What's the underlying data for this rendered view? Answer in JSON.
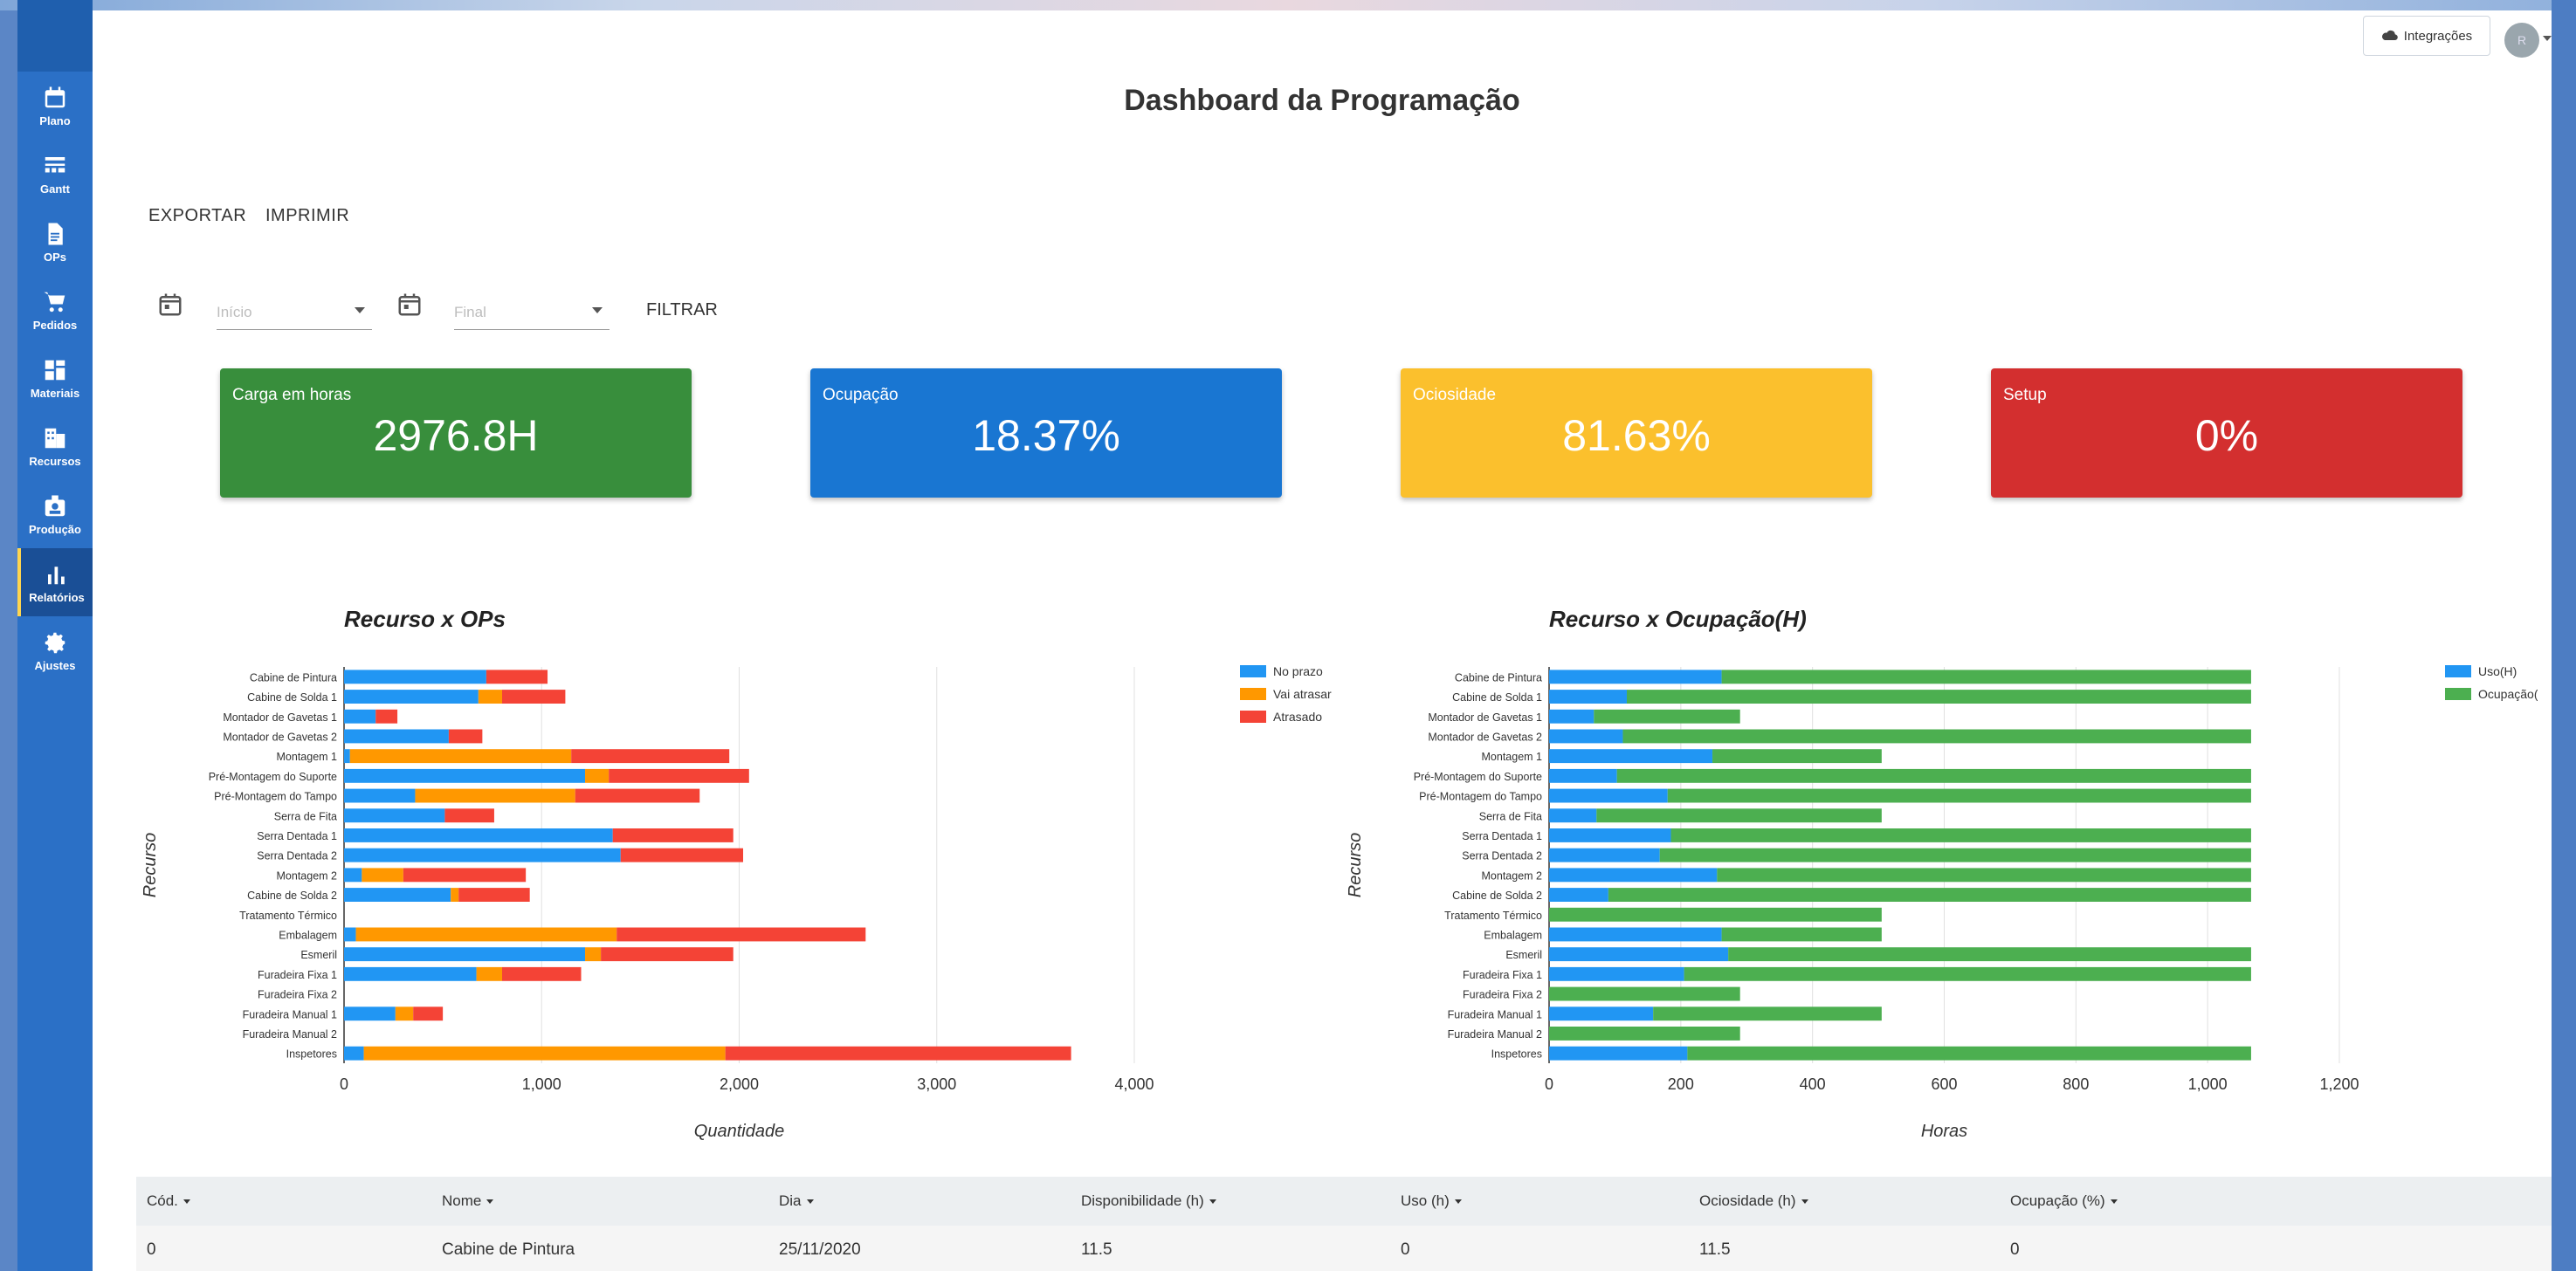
{
  "header": {
    "integrations_label": "Integrações",
    "avatar_initials": "R"
  },
  "sidebar": {
    "items": [
      {
        "label": "Plano",
        "icon": "calendar-icon"
      },
      {
        "label": "Gantt",
        "icon": "gantt-icon"
      },
      {
        "label": "OPs",
        "icon": "document-icon"
      },
      {
        "label": "Pedidos",
        "icon": "cart-icon"
      },
      {
        "label": "Materiais",
        "icon": "grid-icon"
      },
      {
        "label": "Recursos",
        "icon": "building-icon"
      },
      {
        "label": "Produção",
        "icon": "badge-icon"
      },
      {
        "label": "Relatórios",
        "icon": "bar-chart-icon",
        "active": true
      },
      {
        "label": "Ajustes",
        "icon": "gear-icon"
      }
    ]
  },
  "page": {
    "title": "Dashboard da Programação",
    "export_label": "EXPORTAR",
    "print_label": "IMPRIMIR"
  },
  "filters": {
    "start_placeholder": "Início",
    "end_placeholder": "Final",
    "filter_label": "FILTRAR"
  },
  "kpis": [
    {
      "label": "Carga em horas",
      "value": "2976.8H",
      "color": "#388e3c"
    },
    {
      "label": "Ocupação",
      "value": "18.37%",
      "color": "#1976d2"
    },
    {
      "label": "Ociosidade",
      "value": "81.63%",
      "color": "#fbc02d"
    },
    {
      "label": "Setup",
      "value": "0%",
      "color": "#d32f2f"
    }
  ],
  "chart_data": [
    {
      "type": "bar",
      "orientation": "horizontal",
      "stacked": true,
      "title": "Recurso x OPs",
      "xlabel": "Quantidade",
      "ylabel": "Recurso",
      "xlim": [
        0,
        4000
      ],
      "xticks": [
        "0",
        "1,000",
        "2,000",
        "3,000",
        "4,000"
      ],
      "grid": true,
      "legend_position": "right",
      "categories": [
        "Cabine de Pintura",
        "Cabine de Solda 1",
        "Montador de Gavetas 1",
        "Montador de Gavetas 2",
        "Montagem 1",
        "Pré-Montagem do Suporte",
        "Pré-Montagem do Tampo",
        "Serra de Fita",
        "Serra Dentada 1",
        "Serra Dentada 2",
        "Montagem 2",
        "Cabine de Solda 2",
        "Tratamento Térmico",
        "Embalagem",
        "Esmeril",
        "Furadeira Fixa 1",
        "Furadeira Fixa 2",
        "Furadeira Manual 1",
        "Furadeira Manual 2",
        "Inspetores"
      ],
      "series": [
        {
          "name": "No prazo",
          "color": "#2196f3",
          "values": [
            720,
            680,
            160,
            530,
            30,
            1220,
            360,
            510,
            1360,
            1400,
            90,
            540,
            0,
            60,
            1220,
            670,
            0,
            260,
            0,
            100
          ]
        },
        {
          "name": "Vai atrasar",
          "color": "#ff9800",
          "values": [
            0,
            120,
            0,
            0,
            1120,
            120,
            810,
            0,
            0,
            0,
            210,
            40,
            0,
            1320,
            80,
            130,
            0,
            90,
            0,
            1830
          ]
        },
        {
          "name": "Atrasado",
          "color": "#f44336",
          "values": [
            310,
            320,
            110,
            170,
            800,
            710,
            630,
            250,
            610,
            620,
            620,
            360,
            0,
            1260,
            670,
            400,
            0,
            150,
            0,
            1750
          ]
        }
      ]
    },
    {
      "type": "bar",
      "orientation": "horizontal",
      "stacked": true,
      "title": "Recurso x Ocupação(H)",
      "xlabel": "Horas",
      "ylabel": "Recurso",
      "xlim": [
        0,
        1200
      ],
      "xticks": [
        "0",
        "200",
        "400",
        "600",
        "800",
        "1,000",
        "1,200"
      ],
      "grid": true,
      "legend_position": "right",
      "categories": [
        "Cabine de Pintura",
        "Cabine de Solda 1",
        "Montador de Gavetas 1",
        "Montador de Gavetas 2",
        "Montagem 1",
        "Pré-Montagem do Suporte",
        "Pré-Montagem do Tampo",
        "Serra de Fita",
        "Serra Dentada 1",
        "Serra Dentada 2",
        "Montagem 2",
        "Cabine de Solda 2",
        "Tratamento Térmico",
        "Embalagem",
        "Esmeril",
        "Furadeira Fixa 1",
        "Furadeira Fixa 2",
        "Furadeira Manual 1",
        "Furadeira Manual 2",
        "Inspetores"
      ],
      "series": [
        {
          "name": "Uso(H)",
          "color": "#2196f3",
          "values": [
            262,
            118,
            68,
            112,
            248,
            103,
            180,
            72,
            185,
            168,
            255,
            90,
            0,
            262,
            272,
            205,
            0,
            158,
            0,
            210
          ]
        },
        {
          "name": "Ocupação(H)",
          "color": "#4caf50",
          "values": [
            804,
            948,
            222,
            954,
            257,
            963,
            886,
            433,
            881,
            898,
            811,
            976,
            505,
            243,
            794,
            861,
            290,
            347,
            290,
            856
          ]
        }
      ]
    }
  ],
  "table": {
    "headers": [
      "Cód.",
      "Nome",
      "Dia",
      "Disponibilidade (h)",
      "Uso (h)",
      "Ociosidade (h)",
      "Ocupação (%)"
    ],
    "rows": [
      [
        "0",
        "Cabine de Pintura",
        "25/11/2020",
        "11.5",
        "0",
        "11.5",
        "0"
      ]
    ]
  }
}
